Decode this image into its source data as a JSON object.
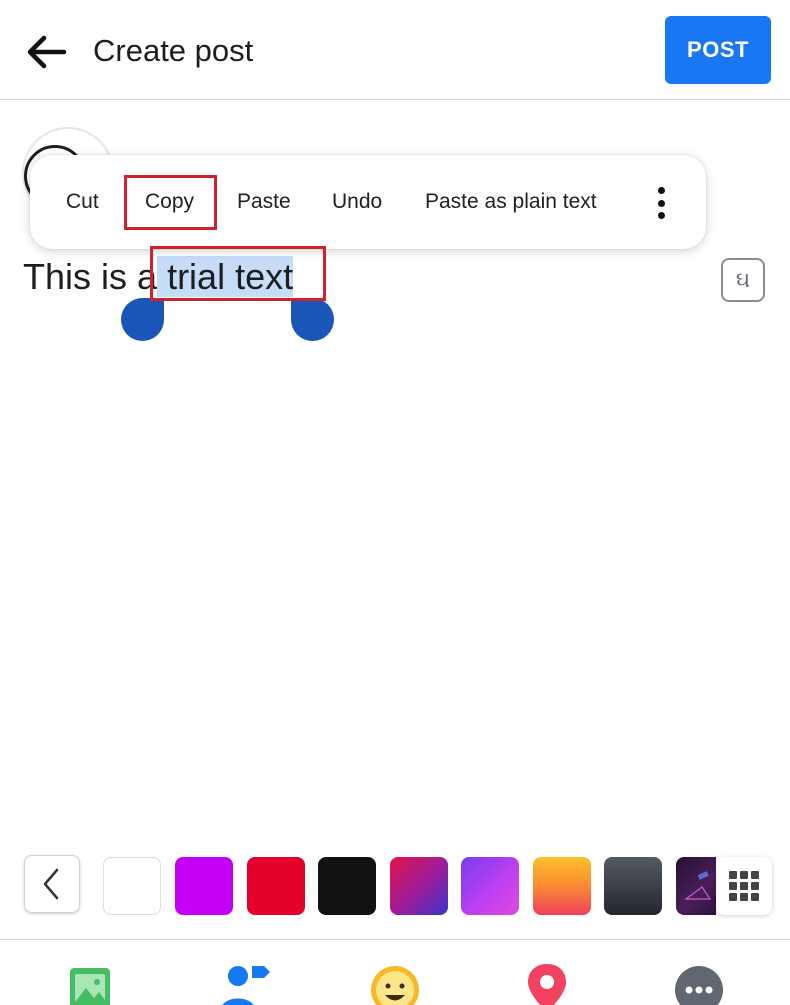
{
  "header": {
    "title": "Create post",
    "post_label": "POST",
    "accent_color": "#1877f2"
  },
  "selection_toolbar": {
    "cut": "Cut",
    "copy": "Copy",
    "paste": "Paste",
    "undo": "Undo",
    "paste_plain": "Paste as plain text",
    "more_icon": "more-vertical-icon"
  },
  "post": {
    "text_before": "This is a",
    "text_selected": "trial text",
    "selection_color": "#c6dcf7"
  },
  "language_icon": "ઘ",
  "backgrounds": {
    "swatches": [
      {
        "name": "white",
        "color": "#ffffff"
      },
      {
        "name": "purple",
        "color": "#c300f5"
      },
      {
        "name": "red",
        "color": "#e4002b"
      },
      {
        "name": "black",
        "color": "#111111"
      },
      {
        "name": "magenta-blue-gradient",
        "color": "#c21f6b"
      },
      {
        "name": "violet-gradient",
        "color": "#b63ef2"
      },
      {
        "name": "orange-gradient",
        "color": "#fb8a2e"
      },
      {
        "name": "dark-gray-gradient",
        "color": "#3a3d44"
      },
      {
        "name": "space-image",
        "color": "#3b1a4a"
      }
    ]
  },
  "bottom_bar": {
    "items": [
      "photo-icon",
      "tag-people-icon",
      "feeling-icon",
      "location-icon",
      "more-icon"
    ]
  },
  "annotation_color": "#d1212e"
}
